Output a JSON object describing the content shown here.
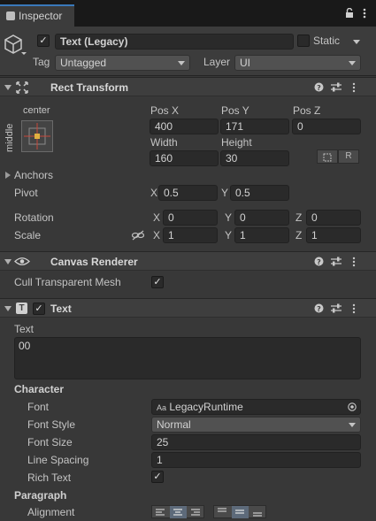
{
  "window": {
    "tab_title": "Inspector",
    "lock_icon": "lock-icon",
    "menu_icon": "kebab-menu-icon"
  },
  "object": {
    "name": "Text (Legacy)",
    "active": true,
    "static_label": "Static",
    "static_checked": false,
    "tag_label": "Tag",
    "tag_value": "Untagged",
    "layer_label": "Layer",
    "layer_value": "UI"
  },
  "rect_transform": {
    "title": "Rect Transform",
    "anchor_h": "center",
    "anchor_v": "middle",
    "pos_x_label": "Pos X",
    "pos_x": "400",
    "pos_y_label": "Pos Y",
    "pos_y": "171",
    "pos_z_label": "Pos Z",
    "pos_z": "0",
    "width_label": "Width",
    "width": "160",
    "height_label": "Height",
    "height": "30",
    "r_button": "R",
    "anchors_label": "Anchors",
    "pivot_label": "Pivot",
    "pivot_x": "0.5",
    "pivot_y": "0.5",
    "rotation_label": "Rotation",
    "rot_x": "0",
    "rot_y": "0",
    "rot_z": "0",
    "scale_label": "Scale",
    "scale_x": "1",
    "scale_y": "1",
    "scale_z": "1",
    "x": "X",
    "y": "Y",
    "z": "Z"
  },
  "canvas_renderer": {
    "title": "Canvas Renderer",
    "cull_label": "Cull Transparent Mesh",
    "cull_checked": true
  },
  "text_comp": {
    "title": "Text",
    "enabled": true,
    "text_label": "Text",
    "text_value": "00",
    "character_label": "Character",
    "font_label": "Font",
    "font_value": "LegacyRuntime",
    "font_prefix": "Aa",
    "font_style_label": "Font Style",
    "font_style_value": "Normal",
    "font_size_label": "Font Size",
    "font_size_value": "25",
    "line_spacing_label": "Line Spacing",
    "line_spacing_value": "1",
    "rich_text_label": "Rich Text",
    "rich_text_checked": true,
    "paragraph_label": "Paragraph",
    "alignment_label": "Alignment"
  },
  "check_glyph": "✓"
}
